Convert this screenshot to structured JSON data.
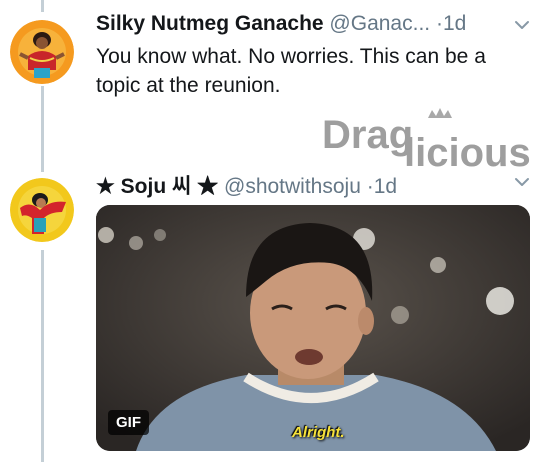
{
  "tweet1": {
    "display_name": "Silky Nutmeg Ganache",
    "handle": "@Ganac...",
    "separator": "·",
    "time": "1d",
    "text": "You know what. No worries. This can be a topic at the reunion."
  },
  "tweet2": {
    "display_name": "★ Soju 씨 ★",
    "handle": "@shotwithsoju",
    "separator": "·",
    "time": "1d",
    "media": {
      "type_badge": "GIF",
      "caption": "Alright."
    }
  },
  "watermark": {
    "text_part1": "Drag",
    "text_part2": "licious"
  },
  "icons": {
    "chevron": "chevron-down-icon"
  },
  "colors": {
    "text_primary": "#14171a",
    "text_secondary": "#657786",
    "thread_line": "#c4cfd6",
    "watermark": "#9e9e9e",
    "subtitle": "#f6e23a"
  }
}
